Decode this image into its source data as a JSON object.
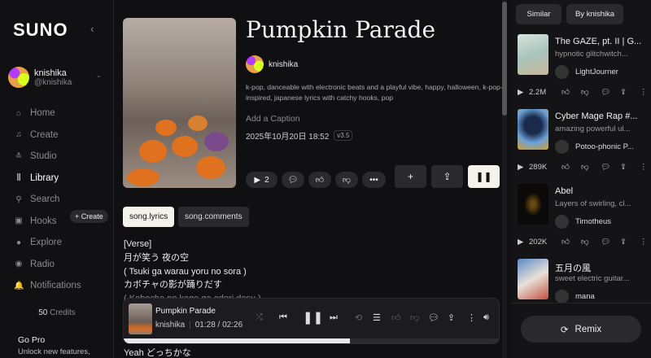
{
  "sidebar": {
    "logo": "SUNO",
    "user": {
      "name": "knishika",
      "handle": "@knishika"
    },
    "items": [
      {
        "label": "Home",
        "icon": "home-icon",
        "glyph": "⌂"
      },
      {
        "label": "Create",
        "icon": "music-note-icon",
        "glyph": "♫"
      },
      {
        "label": "Studio",
        "icon": "studio-icon",
        "glyph": "≛"
      },
      {
        "label": "Library",
        "icon": "library-icon",
        "glyph": "⫼"
      },
      {
        "label": "Search",
        "icon": "search-icon",
        "glyph": "⚲"
      },
      {
        "label": "Hooks",
        "icon": "hooks-icon",
        "glyph": "▣"
      },
      {
        "label": "Explore",
        "icon": "explore-icon",
        "glyph": "●"
      },
      {
        "label": "Radio",
        "icon": "radio-icon",
        "glyph": "◉"
      },
      {
        "label": "Notifications",
        "icon": "bell-icon",
        "glyph": "🔔"
      }
    ],
    "active": "Library",
    "hooks_create": "+ Create",
    "credits_num": "50",
    "credits_label": "Credits",
    "gopro": "Go Pro",
    "gopro_sub": "Unlock new features,"
  },
  "song": {
    "title": "Pumpkin Parade",
    "artist": "knishika",
    "tags": "k-pop, danceable with electronic beats and a playful vibe, happy, halloween, k-pop-inspired, japanese lyrics with catchy hooks, pop",
    "caption_placeholder": "Add a Caption",
    "date": "2025年10月20日 18:52",
    "version": "v3.5",
    "play_count": "2"
  },
  "tabs": [
    {
      "label": "song.lyrics",
      "active": true
    },
    {
      "label": "song.comments",
      "active": false
    }
  ],
  "lyrics": [
    "[Verse]",
    "月が笑う 夜の空",
    "( Tsuki ga warau yoru no sora )",
    "カボチャの影が踊りだす",
    "( Kabocha no kage ga odori dasu )"
  ],
  "lyrics_after": "Yeah どっちかな",
  "player": {
    "title": "Pumpkin Parade",
    "artist": "knishika",
    "current": "01:28",
    "total": "02:26",
    "progress_percent": 60.3
  },
  "right": {
    "tabs": [
      "Similar",
      "By knishika"
    ],
    "songs": [
      {
        "title": "The GAZE, pt. II | G...",
        "desc": "hypnotic glitchwitch...",
        "artist": "LightJourner",
        "plays": "2.2M"
      },
      {
        "title": "Cyber Mage Rap #...",
        "desc": "amazing powerful ul...",
        "artist": "Potoo-phonic P...",
        "plays": "289K"
      },
      {
        "title": "Abel",
        "desc": "Layers of swirling, cl...",
        "artist": "Timotheus",
        "plays": "202K"
      },
      {
        "title": "五月の風",
        "desc": "sweet electric guitar...",
        "artist": "mana",
        "plays": ""
      }
    ],
    "remix": "Remix"
  },
  "colors": {
    "background": "#101012",
    "accent_button": "#f5f2ec",
    "surface": "#2a2a2e"
  }
}
